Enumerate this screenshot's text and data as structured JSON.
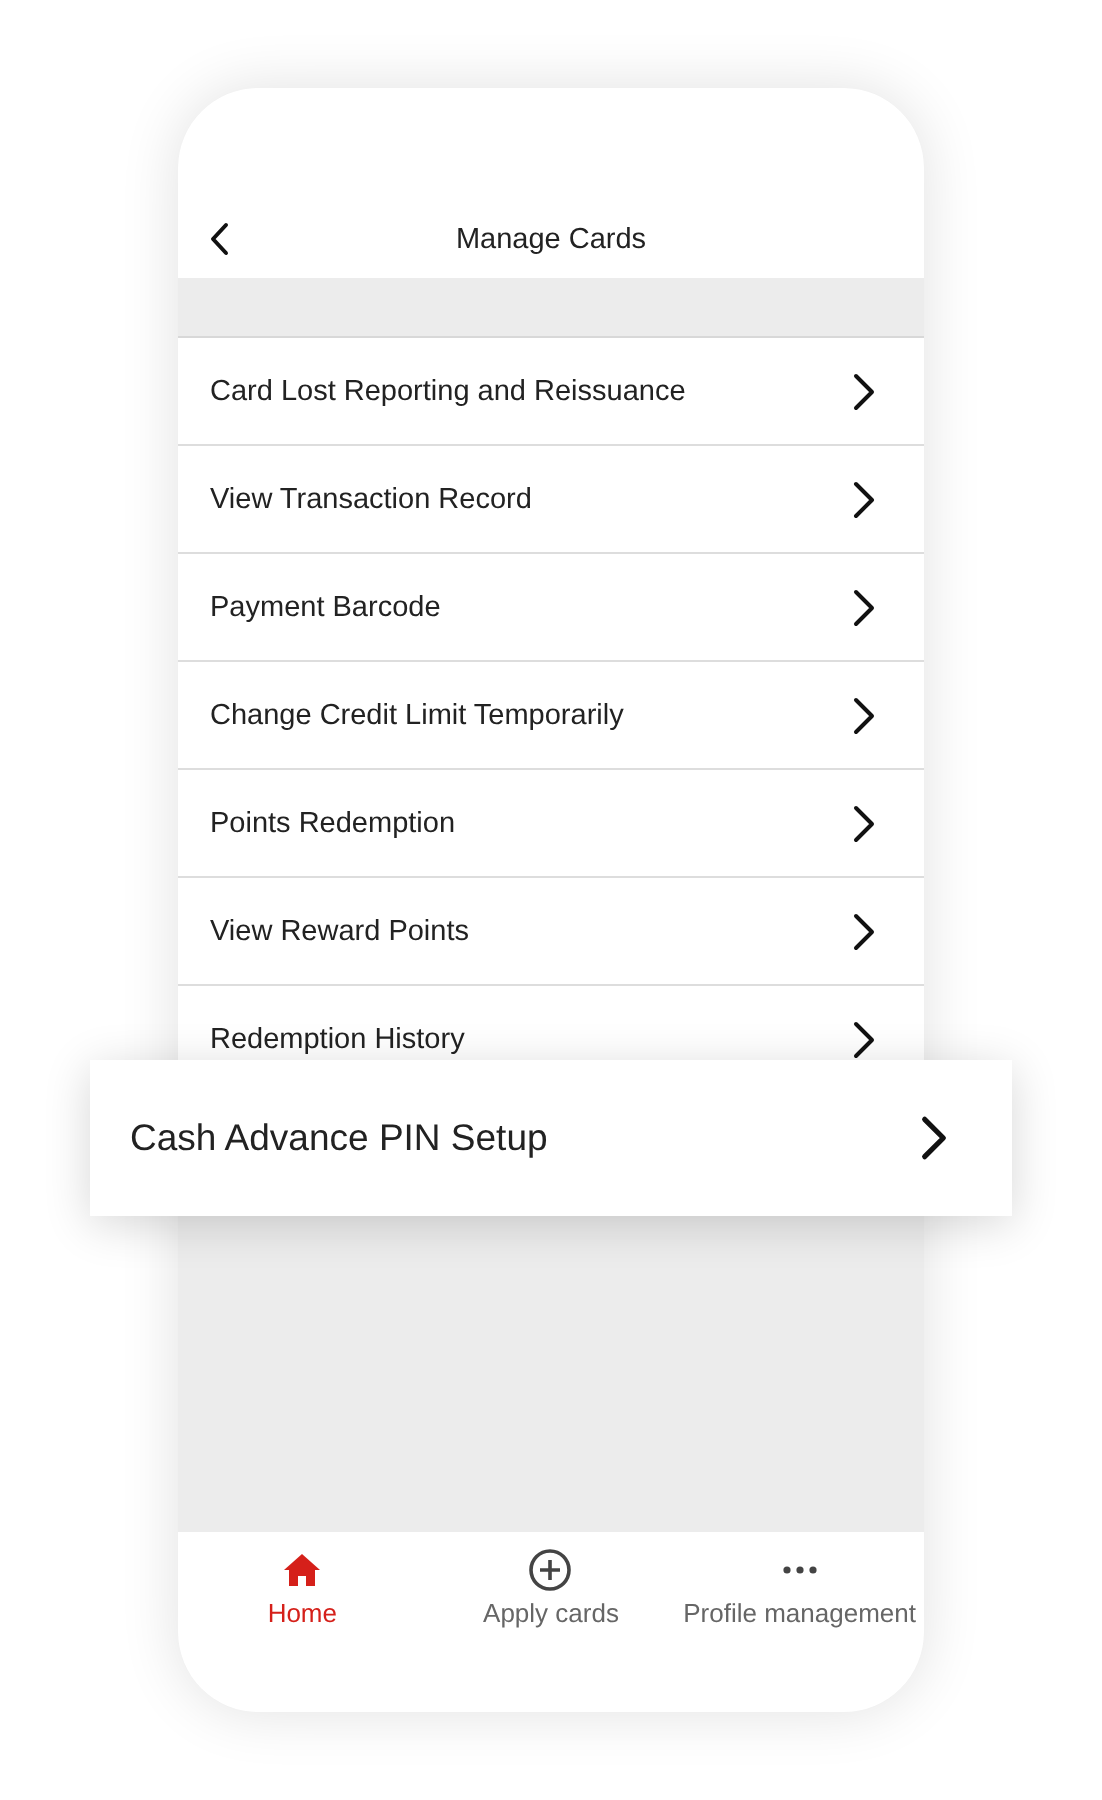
{
  "header": {
    "title": "Manage Cards"
  },
  "menu_items": [
    {
      "label": "Card Lost Reporting and Reissuance"
    },
    {
      "label": "View Transaction Record"
    },
    {
      "label": "Payment Barcode"
    },
    {
      "label": "Change Credit Limit Temporarily"
    },
    {
      "label": "Points Redemption"
    },
    {
      "label": "View Reward Points"
    },
    {
      "label": "Redemption History"
    }
  ],
  "highlighted_item": {
    "label": "Cash Advance PIN Setup"
  },
  "tab_bar": [
    {
      "kind": "home",
      "label": "Home",
      "selected": true
    },
    {
      "kind": "plus",
      "label": "Apply cards",
      "selected": false
    },
    {
      "kind": "more",
      "label": "Profile management",
      "selected": false
    }
  ]
}
